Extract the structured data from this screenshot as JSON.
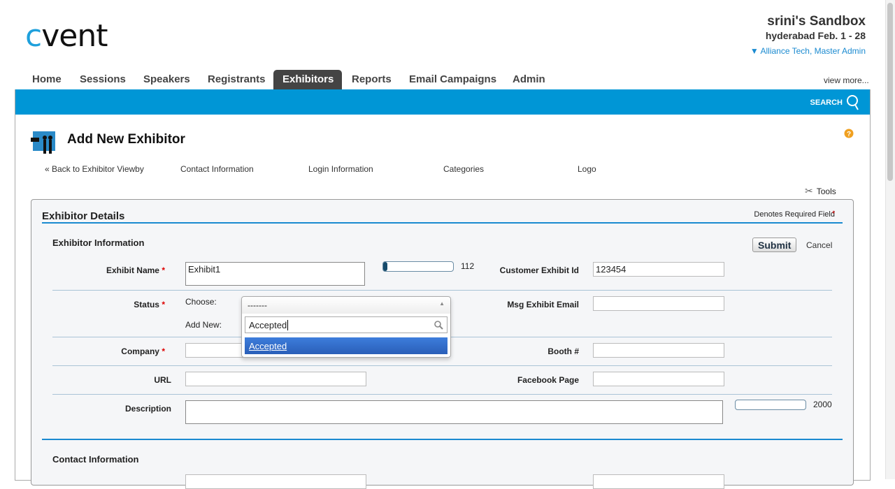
{
  "brand": {
    "logo_text_c": "c",
    "logo_text_rest": "vent"
  },
  "account": {
    "sandbox": "srini's Sandbox",
    "event": "hyderabad Feb. 1 - 28",
    "user": "Alliance Tech, Master Admin"
  },
  "nav": {
    "tabs": [
      "Home",
      "Sessions",
      "Speakers",
      "Registrants",
      "Exhibitors",
      "Reports",
      "Email Campaigns",
      "Admin"
    ],
    "active": "Exhibitors",
    "view_more": "view more..."
  },
  "search": {
    "label": "SEARCH"
  },
  "page": {
    "title": "Add New Exhibitor",
    "links": [
      "« Back to Exhibitor Viewby",
      "Contact Information",
      "Login Information",
      "Categories",
      "Logo"
    ],
    "tools": "Tools"
  },
  "section": {
    "title": "Exhibitor Details",
    "required_note": "Denotes Required Field",
    "required_mark": "*",
    "subsection": "Exhibitor Information",
    "submit": "Submit",
    "cancel": "Cancel",
    "next_subsection": "Contact Information"
  },
  "fields": {
    "exhibit_name": {
      "label": "Exhibit Name",
      "value": "Exhibit1",
      "remaining": "112"
    },
    "customer_exhibit_id": {
      "label": "Customer Exhibit Id",
      "value": "123454"
    },
    "status": {
      "label": "Status",
      "choose": "Choose:",
      "add_new": "Add New:",
      "selected": "-------",
      "search_value": "Accepted",
      "option": "Accepted"
    },
    "msg_exhibit_email": {
      "label": "Msg Exhibit Email",
      "value": ""
    },
    "company": {
      "label": "Company",
      "value": ""
    },
    "booth": {
      "label": "Booth #",
      "value": ""
    },
    "url": {
      "label": "URL",
      "value": ""
    },
    "facebook": {
      "label": "Facebook Page",
      "value": ""
    },
    "description": {
      "label": "Description",
      "value": "",
      "remaining": "2000"
    }
  },
  "colors": {
    "brand_blue": "#0096d6",
    "active_tab": "#444444",
    "highlight": "#3a72d0",
    "required": "#dd0000"
  }
}
